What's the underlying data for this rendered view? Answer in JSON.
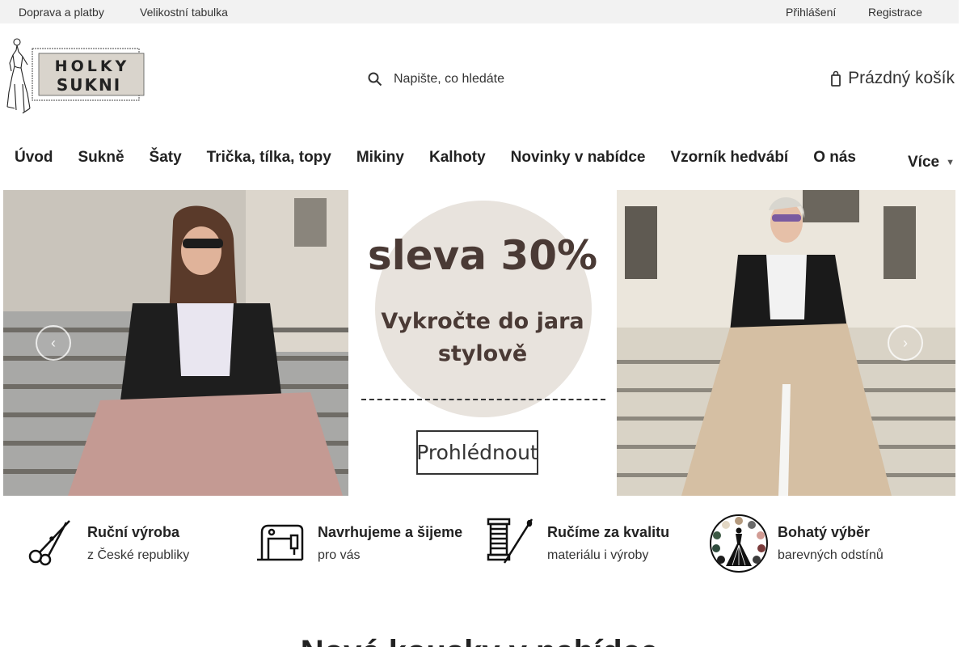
{
  "topbar": {
    "links": [
      "Doprava a platby",
      "Velikostní tabulka"
    ],
    "account": {
      "login": "Přihlášení",
      "register": "Registrace"
    }
  },
  "logo": {
    "line1": "HOLKY",
    "line2": "SUKNI"
  },
  "search": {
    "placeholder": "Napište, co hledáte",
    "icon": "search-icon"
  },
  "cart": {
    "label": "Prázdný košík",
    "icon": "shopping-bag-icon"
  },
  "nav": {
    "items": [
      "Úvod",
      "Sukně",
      "Šaty",
      "Trička, tílka, topy",
      "Mikiny",
      "Kalhoty",
      "Novinky v nabídce",
      "Vzorník hedvábí",
      "O nás"
    ],
    "more": "Více"
  },
  "banner": {
    "title": "sleva 30%",
    "subtitle_line1": "Vykročte do jara",
    "subtitle_line2": "stylově",
    "button": "Prohlédnout"
  },
  "features": [
    {
      "title": "Ruční výroba",
      "subtitle": "z České republiky",
      "icon": "scissors-icon"
    },
    {
      "title": "Navrhujeme a šijeme",
      "subtitle": "pro vás",
      "icon": "sewing-machine-icon"
    },
    {
      "title": "Ručíme za kvalitu",
      "subtitle": "materiálu i výroby",
      "icon": "thread-spool-icon"
    },
    {
      "title": "Bohatý výběr",
      "subtitle": "barevných odstínů",
      "icon": "color-palette-icon"
    }
  ],
  "section": {
    "heading": "Nové kousky v nabídce"
  },
  "colors": {
    "topbar_bg": "#f2f2f2",
    "promo_circle": "#e8e3dd",
    "promo_text": "#4a3a35"
  }
}
